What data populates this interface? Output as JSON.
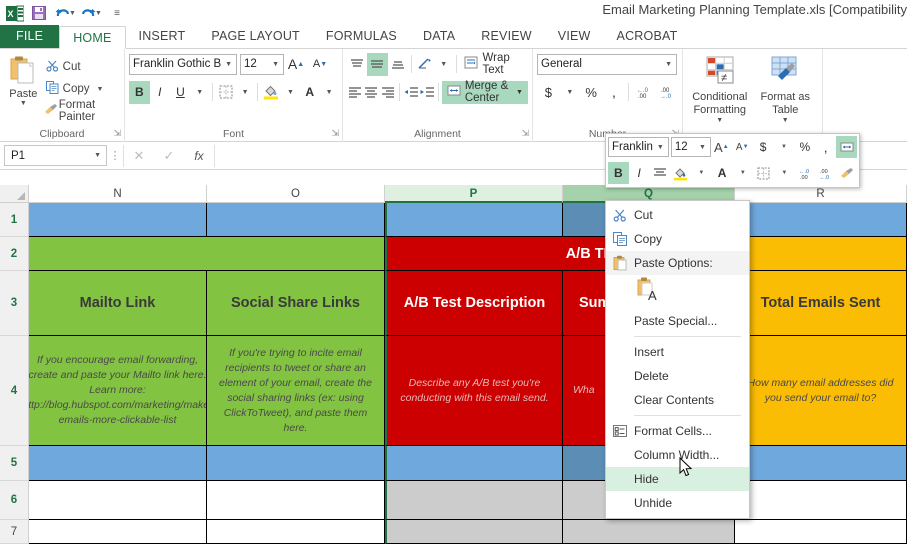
{
  "window": {
    "title": "Email Marketing Planning Template.xls  [Compatibility"
  },
  "quick_access": {
    "save_label": "Save",
    "undo_label": "Undo",
    "redo_label": "Redo",
    "customize_label": "Customize Quick Access Toolbar"
  },
  "ribbon_tabs": [
    {
      "label": "FILE",
      "active": false
    },
    {
      "label": "HOME",
      "active": true
    },
    {
      "label": "INSERT",
      "active": false
    },
    {
      "label": "PAGE LAYOUT",
      "active": false
    },
    {
      "label": "FORMULAS",
      "active": false
    },
    {
      "label": "DATA",
      "active": false
    },
    {
      "label": "REVIEW",
      "active": false
    },
    {
      "label": "VIEW",
      "active": false
    },
    {
      "label": "ACROBAT",
      "active": false
    }
  ],
  "ribbon": {
    "clipboard": {
      "group_label": "Clipboard",
      "paste": "Paste",
      "cut": "Cut",
      "copy": "Copy",
      "format_painter": "Format Painter"
    },
    "font": {
      "group_label": "Font",
      "font_name": "Franklin Gothic B",
      "font_size": "12",
      "grow_font": "A",
      "shrink_font": "A",
      "bold": "B",
      "italic": "I",
      "underline": "U",
      "borders": "Borders",
      "fill_color": "Fill Color",
      "font_color": "A"
    },
    "alignment": {
      "group_label": "Alignment",
      "wrap_text": "Wrap Text",
      "merge_center": "Merge & Center",
      "orientation": "Orientation",
      "decrease_indent": "Decrease Indent",
      "increase_indent": "Increase Indent"
    },
    "number": {
      "group_label": "Number",
      "format": "General",
      "accounting": "$",
      "percent": "%",
      "comma": ",",
      "increase_decimal": ".00",
      "decrease_decimal": ".00"
    },
    "styles": {
      "conditional_formatting": "Conditional Formatting",
      "format_as_table": "Format as Table"
    }
  },
  "formula_bar": {
    "name_box": "P1",
    "cancel": "Cancel",
    "enter": "Enter",
    "insert_function": "fx",
    "value": ""
  },
  "mini_toolbar": {
    "font_name": "Franklin",
    "font_size": "12",
    "grow_font": "A",
    "shrink_font": "A",
    "accounting": "$",
    "percent": "%",
    "comma": ",",
    "merge_center": "Merge & Center",
    "bold": "B",
    "italic": "I",
    "align": "Align",
    "fill_color": "Fill Color",
    "font_color": "A",
    "borders": "Borders",
    "increase_decimal": ".00",
    "decrease_decimal": ".00",
    "format_painter": "Format Painter"
  },
  "context_menu": {
    "items": [
      {
        "label": "Cut",
        "icon": "scissors-icon",
        "type": "item",
        "highlighted": false
      },
      {
        "label": "Copy",
        "icon": "copy-icon",
        "type": "item",
        "highlighted": false
      },
      {
        "label": "Paste Options:",
        "icon": "paste-icon",
        "type": "header",
        "highlighted": false
      },
      {
        "label": "",
        "icon": "paste-values-icon",
        "type": "paste-gallery",
        "highlighted": false
      },
      {
        "label": "Paste Special...",
        "icon": "",
        "type": "item",
        "highlighted": false
      },
      {
        "label": "Insert",
        "icon": "",
        "type": "item",
        "highlighted": false
      },
      {
        "label": "Delete",
        "icon": "",
        "type": "item",
        "highlighted": false
      },
      {
        "label": "Clear Contents",
        "icon": "",
        "type": "item",
        "highlighted": false
      },
      {
        "label": "Format Cells...",
        "icon": "format-cells-icon",
        "type": "item",
        "highlighted": false
      },
      {
        "label": "Column Width...",
        "icon": "",
        "type": "item",
        "highlighted": false
      },
      {
        "label": "Hide",
        "icon": "",
        "type": "item",
        "highlighted": true
      },
      {
        "label": "Unhide",
        "icon": "",
        "type": "item",
        "highlighted": false
      }
    ]
  },
  "sheet": {
    "column_headers": [
      {
        "label": "N",
        "state": "normal"
      },
      {
        "label": "O",
        "state": "normal"
      },
      {
        "label": "P",
        "state": "selected"
      },
      {
        "label": "Q",
        "state": "selected-hover"
      },
      {
        "label": "R",
        "state": "normal"
      }
    ],
    "row_headers": [
      {
        "label": "1",
        "selected": true
      },
      {
        "label": "2",
        "selected": true
      },
      {
        "label": "3",
        "selected": true
      },
      {
        "label": "4",
        "selected": true
      },
      {
        "label": "5",
        "selected": true
      },
      {
        "label": "6",
        "selected": true
      },
      {
        "label": "7",
        "selected": false
      }
    ],
    "banner_row2": {
      "text": "A/B TEST PLANNING &",
      "color": "#cc0000"
    },
    "headers_row3": {
      "N": "Mailto Link",
      "O": "Social Share Links",
      "P": "A/B Test Description",
      "Q": "Sum",
      "R": "Total Emails Sent"
    },
    "descriptions_row4": {
      "N": "If you encourage email forwarding, create and paste your Mailto link here. Learn more: http://blog.hubspot.com/marketing/make-emails-more-clickable-list",
      "O": "If you're trying to incite email recipients to tweet or share an element of your email, create the social sharing links (ex: using ClickToTweet), and paste them here.",
      "P": "Describe any A/B test you're conducting with this email send.",
      "Q": "Wha",
      "R": "How many email addresses did you send your email to?"
    },
    "colors": {
      "blue": "#6fa8dc",
      "blue_dark": "#5b8db5",
      "green": "#82c341",
      "red": "#cc0000",
      "orange": "#fbbc04",
      "gray": "#cccccc",
      "selection_green": "#217346"
    }
  }
}
